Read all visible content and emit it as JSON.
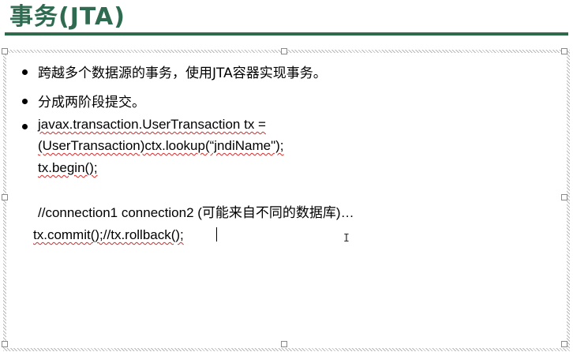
{
  "slide": {
    "title": "事务(JTA)",
    "bullets": [
      "跨越多个数据源的事务，使用JTA容器实现事务。",
      "分成两阶段提交。"
    ],
    "code_line_1": "javax.transaction.UserTransaction tx =",
    "code_line_2": "(UserTransaction)ctx.lookup(“jndiName\");",
    "code_line_3": "tx.begin();",
    "code_line_4": "//connection1 connection2 (可能来自不同的数据库)…",
    "code_line_5": "tx.commit();//tx.rollback();"
  },
  "colors": {
    "title": "#2f6b50",
    "rule": "#2e6b4d",
    "spellcheck": "#d42a2a"
  },
  "icons": {
    "cursor": "i-beam-cursor"
  }
}
